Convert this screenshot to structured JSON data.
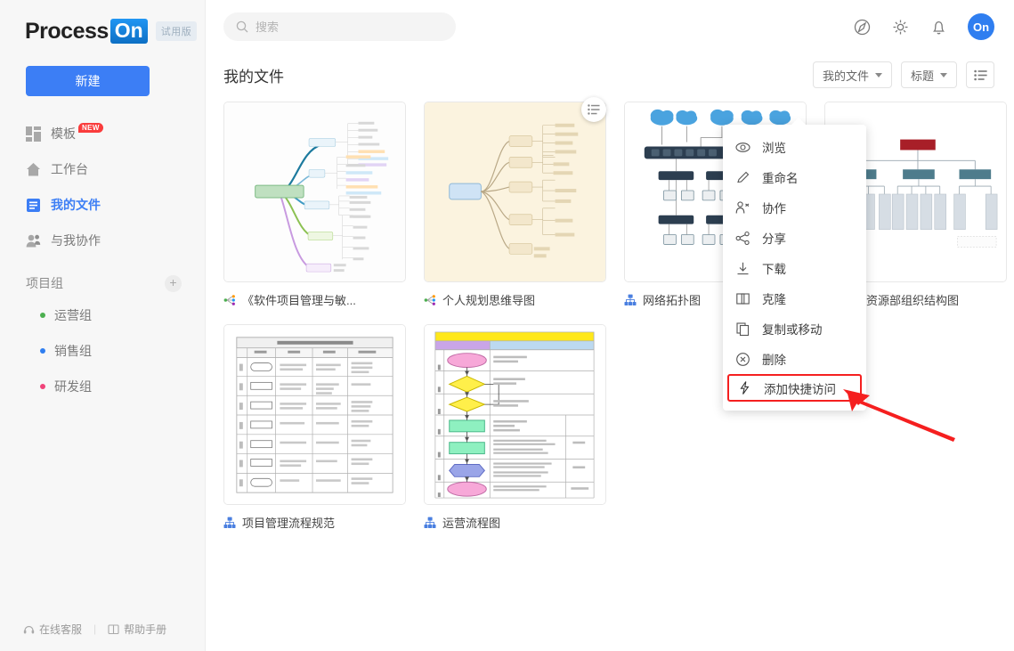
{
  "brand": {
    "name_part1": "Process",
    "name_part2": "On",
    "trial_badge": "试用版",
    "accent_color": "#3c7ef5"
  },
  "sidebar": {
    "new_button": "新建",
    "items": [
      {
        "label": "模板",
        "icon": "grid-icon",
        "badge": "NEW",
        "active": false
      },
      {
        "label": "工作台",
        "icon": "home-icon",
        "badge": "",
        "active": false
      },
      {
        "label": "我的文件",
        "icon": "document-icon",
        "badge": "",
        "active": true
      },
      {
        "label": "与我协作",
        "icon": "users-icon",
        "badge": "",
        "active": false
      }
    ],
    "group_title": "项目组",
    "add_group_icon": "plus-icon",
    "groups": [
      {
        "label": "运营组",
        "color": "#4caf50"
      },
      {
        "label": "销售组",
        "color": "#2f7ef0"
      },
      {
        "label": "研发组",
        "color": "#f0447a"
      }
    ],
    "footer": {
      "support": "在线客服",
      "support_icon": "headset-icon",
      "manual": "帮助手册",
      "manual_icon": "book-icon",
      "separator": "|"
    }
  },
  "topbar": {
    "search_placeholder": "搜索",
    "search_value": "",
    "search_icon": "search-icon",
    "icons": [
      {
        "name": "compass-icon"
      },
      {
        "name": "gear-icon"
      },
      {
        "name": "bell-icon"
      }
    ],
    "avatar_text": "On"
  },
  "page": {
    "title": "我的文件",
    "filter_dropdown": "我的文件",
    "sort_dropdown": "标题",
    "view_toggle_icon": "list-view-icon"
  },
  "files": [
    {
      "name": "《软件项目管理与敏...",
      "icon": "mindmap-icon",
      "thumb": "mindmap"
    },
    {
      "name": "个人规划思维导图",
      "icon": "mindmap-icon",
      "thumb": "mindmap2"
    },
    {
      "name": "网络拓扑图",
      "icon": "flowchart-icon",
      "thumb": "topology"
    },
    {
      "name": "人力资源部组织结构图",
      "icon": "flowchart-icon",
      "thumb": "orgchart"
    },
    {
      "name": "项目管理流程规范",
      "icon": "flowchart-icon",
      "thumb": "table"
    },
    {
      "name": "运营流程图",
      "icon": "flowchart-icon",
      "thumb": "flowchart"
    }
  ],
  "context_menu": {
    "items": [
      {
        "label": "浏览",
        "icon": "eye-icon",
        "highlighted": false
      },
      {
        "label": "重命名",
        "icon": "pencil-icon",
        "highlighted": false
      },
      {
        "label": "协作",
        "icon": "collaborate-icon",
        "highlighted": false
      },
      {
        "label": "分享",
        "icon": "share-icon",
        "highlighted": false
      },
      {
        "label": "下载",
        "icon": "download-icon",
        "highlighted": false
      },
      {
        "label": "克隆",
        "icon": "clone-icon",
        "highlighted": false
      },
      {
        "label": "复制或移动",
        "icon": "copy-icon",
        "highlighted": false
      },
      {
        "label": "删除",
        "icon": "delete-icon",
        "highlighted": false
      },
      {
        "label": "添加快捷访问",
        "icon": "lightning-icon",
        "highlighted": true
      }
    ],
    "highlight_color": "#f51f1f",
    "annotation_arrow_color": "#f51f1f"
  }
}
